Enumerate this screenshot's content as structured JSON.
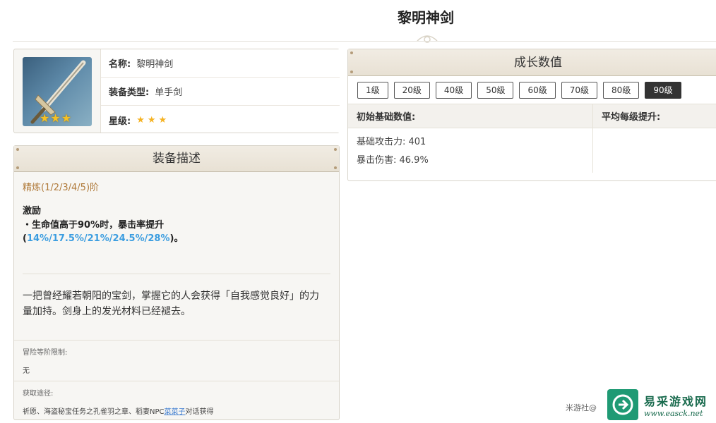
{
  "page": {
    "title": "黎明神剑"
  },
  "info": {
    "name_key": "名称:",
    "name_val": "黎明神剑",
    "type_key": "装备类型:",
    "type_val": "单手剑",
    "rarity_key": "星级:",
    "rarity_stars": "★★★",
    "rarity_count": 3,
    "image_badge_stars": "★★★"
  },
  "description": {
    "header": "装备描述",
    "refine": "精炼(1/2/3/4/5)阶",
    "passive_name": "激励",
    "passive_prefix": "・生命值高于90%时，暴击率提升(",
    "passive_values": "14%/17.5%/21%/24.5%/28%",
    "passive_suffix": ")。",
    "lore": "一把曾经耀若朝阳的宝剑，掌握它的人会获得「自我感觉良好」的力量加持。剑身上的发光材料已经褪去。",
    "req_label": "冒险等阶限制:",
    "req_value": "无",
    "source_label": "获取途径:",
    "source_prefix": "祈愿、海盗秘宝任务之孔雀羽之章、稻妻NPC",
    "source_link": "菜菜子",
    "source_suffix": "对话获得"
  },
  "growth": {
    "header": "成长数值",
    "levels": [
      "1级",
      "20级",
      "40级",
      "50级",
      "60级",
      "70级",
      "80级",
      "90级"
    ],
    "active_level": "90级",
    "col_base": "初始基础数值:",
    "col_avg": "平均每级提升:",
    "base_atk": "基础攻击力: 401",
    "crit_dmg": "暴击伤害: 46.9%"
  },
  "watermark": {
    "small": "米游社@",
    "cn": "易采游戏网",
    "url": "www.easck.net"
  },
  "colors": {
    "accent_gold": "#b07a3a",
    "highlight_blue": "#3b9de0",
    "star": "#f5b324",
    "brand_green": "#1f9a74"
  }
}
